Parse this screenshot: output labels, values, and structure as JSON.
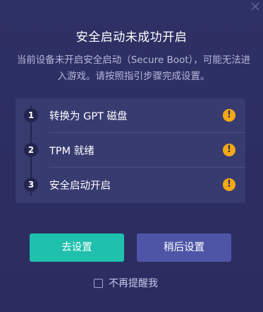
{
  "dialog": {
    "title": "安全启动未成功开启",
    "description": "当前设备未开启安全启动（Secure Boot），可能无法进入游戏。请按照指引步骤完成设置。",
    "close_icon": "close-icon"
  },
  "steps": [
    {
      "number": "1",
      "label": "转换为 GPT 磁盘",
      "status_icon": "warning-icon",
      "status_color": "#f3a814"
    },
    {
      "number": "2",
      "label": "TPM 就绪",
      "status_icon": "warning-icon",
      "status_color": "#f3a814"
    },
    {
      "number": "3",
      "label": "安全启动开启",
      "status_icon": "warning-icon",
      "status_color": "#f3a814"
    }
  ],
  "buttons": {
    "go_settings": "去设置",
    "later": "稍后设置"
  },
  "dont_remind": {
    "label": "不再提醒我",
    "checked": false
  },
  "colors": {
    "background": "#2c2f63",
    "primary_button": "#1fc0ad",
    "secondary_button": "#4f55a6",
    "warning": "#f3a814"
  }
}
